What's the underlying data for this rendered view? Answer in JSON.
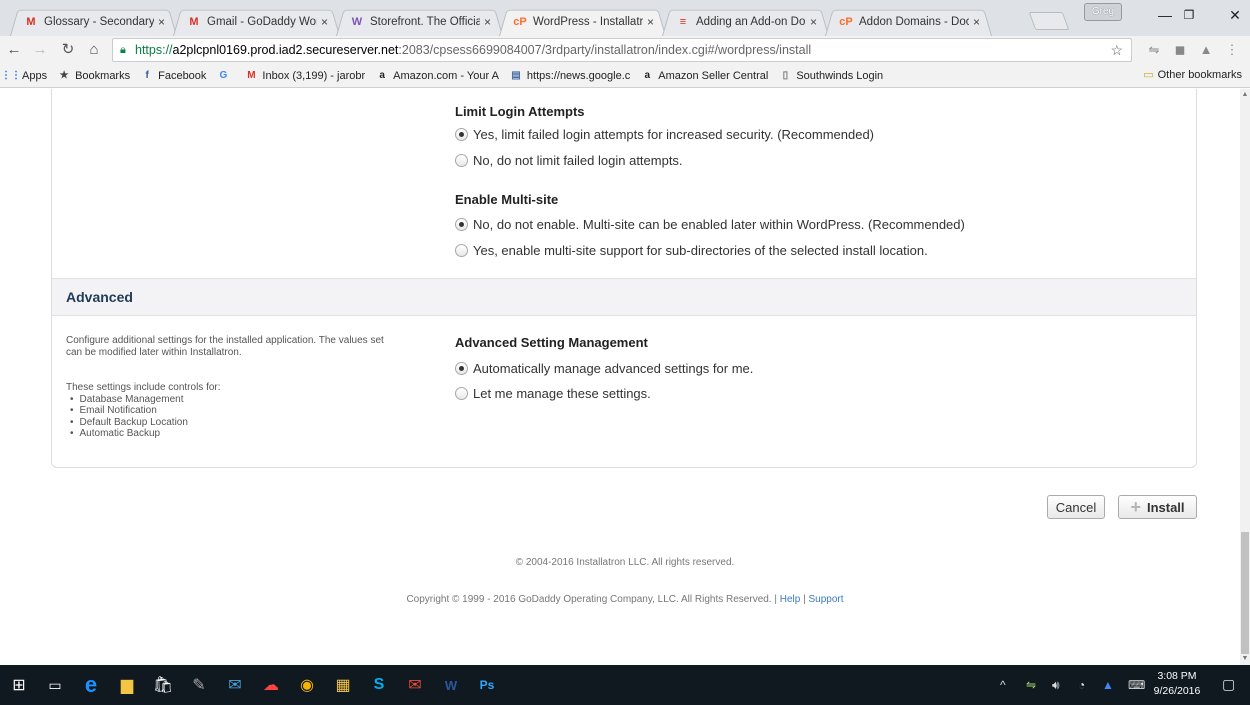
{
  "browser": {
    "tabs": [
      {
        "title": "Glossary - Secondary o",
        "icon": "gmail-icon",
        "glyph": "M",
        "color": "#d93025",
        "active": false
      },
      {
        "title": "Gmail - GoDaddy Word",
        "icon": "gmail-icon",
        "glyph": "M",
        "color": "#d93025",
        "active": false
      },
      {
        "title": "Storefront. The Official",
        "icon": "woocommerce-icon",
        "glyph": "W",
        "color": "#7f54b3",
        "active": false
      },
      {
        "title": "WordPress - Installatro",
        "icon": "installatron-icon",
        "glyph": "cP",
        "color": "#ff6c2c",
        "active": true
      },
      {
        "title": "Adding an Add-on Dom",
        "icon": "flag-icon",
        "glyph": "≡",
        "color": "#d93025",
        "active": false
      },
      {
        "title": "Addon Domains - Docu",
        "icon": "cpanel-icon",
        "glyph": "cP",
        "color": "#ff6c2c",
        "active": false
      }
    ],
    "tab_close": "×",
    "user": "Greg",
    "url_prefix": "https://",
    "url_host": "a2plcpnl0169.prod.iad2.secureserver.net",
    "url_rest": ":2083/cpsess6699084007/3rdparty/installatron/index.cgi#/wordpress/install",
    "bookmarks": [
      {
        "label": "Apps",
        "icon": "apps-icon",
        "glyph": "⋮⋮",
        "color": "#1a73e8"
      },
      {
        "label": "Bookmarks",
        "icon": "star-icon",
        "glyph": "★",
        "color": "#444"
      },
      {
        "label": "Facebook",
        "icon": "facebook-icon",
        "glyph": "f",
        "color": "#3b5998"
      },
      {
        "label": "",
        "icon": "google-icon",
        "glyph": "G",
        "color": "#4285f4"
      },
      {
        "label": "Inbox (3,199) - jarobr",
        "icon": "gmail-icon",
        "glyph": "M",
        "color": "#d93025"
      },
      {
        "label": "Amazon.com - Your A",
        "icon": "amazon-icon",
        "glyph": "a",
        "color": "#222"
      },
      {
        "label": "https://news.google.c",
        "icon": "news-icon",
        "glyph": "▤",
        "color": "#4a6fa5"
      },
      {
        "label": "Amazon Seller Central",
        "icon": "amazon-seller-icon",
        "glyph": "a",
        "color": "#222"
      },
      {
        "label": "Southwinds Login",
        "icon": "page-icon",
        "glyph": "▯",
        "color": "#777"
      }
    ],
    "other_bookmarks": "Other bookmarks"
  },
  "page": {
    "limit_login": {
      "title": "Limit Login Attempts",
      "options": [
        {
          "label": "Yes, limit failed login attempts for increased security. (Recommended)",
          "selected": true
        },
        {
          "label": "No, do not limit failed login attempts.",
          "selected": false
        }
      ]
    },
    "multisite": {
      "title": "Enable Multi-site",
      "options": [
        {
          "label": "No, do not enable. Multi-site can be enabled later within WordPress. (Recommended)",
          "selected": true
        },
        {
          "label": "Yes, enable multi-site support for sub-directories of the selected install location.",
          "selected": false
        }
      ]
    },
    "advanced": {
      "heading": "Advanced",
      "description": "Configure additional settings for the installed application. The values set can be modified later within Installatron.",
      "controls_intro": "These settings include controls for:",
      "controls": [
        "Database Management",
        "Email Notification",
        "Default Backup Location",
        "Automatic Backup"
      ],
      "setting_title": "Advanced Setting Management",
      "options": [
        {
          "label": "Automatically manage advanced settings for me.",
          "selected": true
        },
        {
          "label": "Let me manage these settings.",
          "selected": false
        }
      ]
    },
    "buttons": {
      "cancel": "Cancel",
      "install": "Install"
    },
    "footer": {
      "installatron": "© 2004-2016 Installatron LLC. All rights reserved.",
      "godaddy": "Copyright © 1999 - 2016 GoDaddy Operating Company, LLC. All Rights Reserved.",
      "separator": "|",
      "help": "Help",
      "support": "Support"
    }
  },
  "taskbar": {
    "time": "3:08 PM",
    "date": "9/26/2016"
  }
}
